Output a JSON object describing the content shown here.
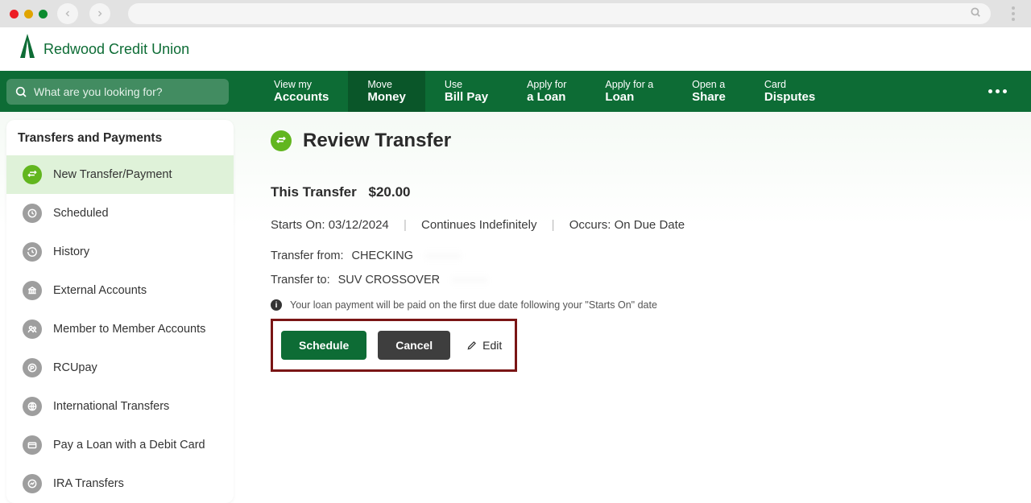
{
  "brand": {
    "name": "Redwood Credit Union"
  },
  "search": {
    "placeholder": "What are you looking for?"
  },
  "topnav": {
    "items": [
      {
        "line1": "View my",
        "line2": "Accounts"
      },
      {
        "line1": "Move",
        "line2": "Money"
      },
      {
        "line1": "Use",
        "line2": "Bill Pay"
      },
      {
        "line1": "Apply for",
        "line2": "a Loan"
      },
      {
        "line1": "Apply for a",
        "line2": "Loan"
      },
      {
        "line1": "Open a",
        "line2": "Share"
      },
      {
        "line1": "Card",
        "line2": "Disputes"
      }
    ]
  },
  "sidebar": {
    "title": "Transfers and Payments",
    "items": [
      {
        "label": "New Transfer/Payment"
      },
      {
        "label": "Scheduled"
      },
      {
        "label": "History"
      },
      {
        "label": "External Accounts"
      },
      {
        "label": "Member to Member Accounts"
      },
      {
        "label": "RCUpay"
      },
      {
        "label": "International Transfers"
      },
      {
        "label": "Pay a Loan with a Debit Card"
      },
      {
        "label": "IRA Transfers"
      }
    ]
  },
  "page": {
    "title": "Review Transfer",
    "this_transfer_label": "This Transfer",
    "amount": "$20.00",
    "starts_on_label": "Starts On:",
    "starts_on_value": "03/12/2024",
    "continues": "Continues Indefinitely",
    "occurs_label": "Occurs:",
    "occurs_value": "On Due Date",
    "from_label": "Transfer from:",
    "from_value": "CHECKING",
    "to_label": "Transfer to:",
    "to_value": "SUV CROSSOVER",
    "note": "Your loan payment will be paid on the first due date following your \"Starts On\" date",
    "actions": {
      "primary": "Schedule",
      "secondary": "Cancel",
      "edit": "Edit"
    }
  }
}
